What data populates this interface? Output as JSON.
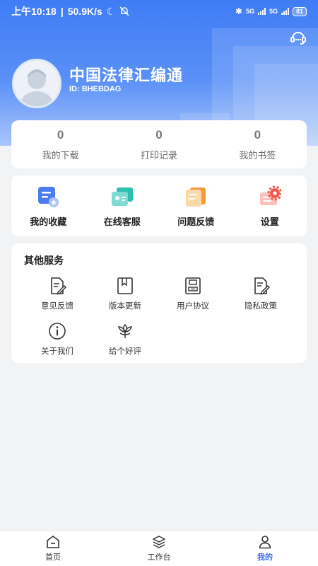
{
  "status_bar": {
    "time": "上午10:18",
    "net_speed": "50.9K/s",
    "net_type_1": "5G",
    "net_type_2": "5G",
    "battery": "81"
  },
  "profile": {
    "app_name": "中国法律汇编通",
    "user_id": "ID: BHEBDAG"
  },
  "stats": [
    {
      "value": "0",
      "label": "我的下载"
    },
    {
      "value": "0",
      "label": "打印记录"
    },
    {
      "value": "0",
      "label": "我的书签"
    }
  ],
  "quick_actions": [
    {
      "label": "我的收藏",
      "icon": "favorites-icon"
    },
    {
      "label": "在线客服",
      "icon": "customer-service-icon"
    },
    {
      "label": "问题反馈",
      "icon": "feedback-icon"
    },
    {
      "label": "设置",
      "icon": "settings-gear-icon"
    }
  ],
  "other_services": {
    "title": "其他服务",
    "items": [
      {
        "label": "意见反馈",
        "icon": "document-pen-icon"
      },
      {
        "label": "版本更新",
        "icon": "bookmark-book-icon"
      },
      {
        "label": "用户协议",
        "icon": "agreement-icon"
      },
      {
        "label": "隐私政策",
        "icon": "privacy-document-icon"
      },
      {
        "label": "关于我们",
        "icon": "info-icon"
      },
      {
        "label": "给个好评",
        "icon": "flower-icon"
      }
    ]
  },
  "tab_bar": {
    "items": [
      {
        "label": "首页",
        "icon": "home-icon"
      },
      {
        "label": "工作台",
        "icon": "layers-icon"
      },
      {
        "label": "我的",
        "icon": "person-icon"
      }
    ],
    "active_index": 2
  },
  "colors": {
    "accent": "#3c6ef0",
    "header_top": "#3f7cf5",
    "header_bottom": "#a9c6fb",
    "background": "#f2f3f5"
  }
}
